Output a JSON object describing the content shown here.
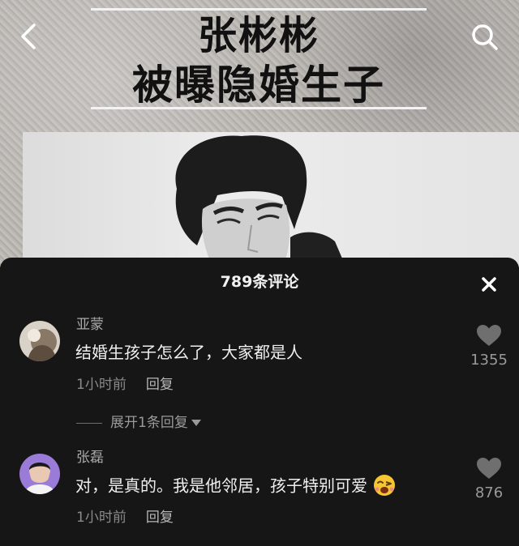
{
  "header": {
    "title_line1": "张彬彬",
    "title_line2": "被曝隐婚生子"
  },
  "comments_sheet": {
    "title": "789条评论"
  },
  "comments": [
    {
      "author": "亚蒙",
      "text": "结婚生孩子怎么了，大家都是人",
      "time": "1小时前",
      "reply_label": "回复",
      "like_count": "1355",
      "expand_label": "展开1条回复"
    },
    {
      "author": "张磊",
      "text": "对，是真的。我是他邻居，孩子特别可爱",
      "time": "1小时前",
      "reply_label": "回复",
      "like_count": "876"
    }
  ],
  "icons": {
    "back": "chevron-left-icon",
    "search": "search-icon",
    "close": "close-icon",
    "like": "heart-icon",
    "expand": "caret-down-icon",
    "emoji": "winking-face-emoji"
  },
  "colors": {
    "sheet_bg": "#161616",
    "text_primary": "#efefef",
    "text_secondary": "#9a9a9a",
    "heart": "#6f6f6f"
  }
}
